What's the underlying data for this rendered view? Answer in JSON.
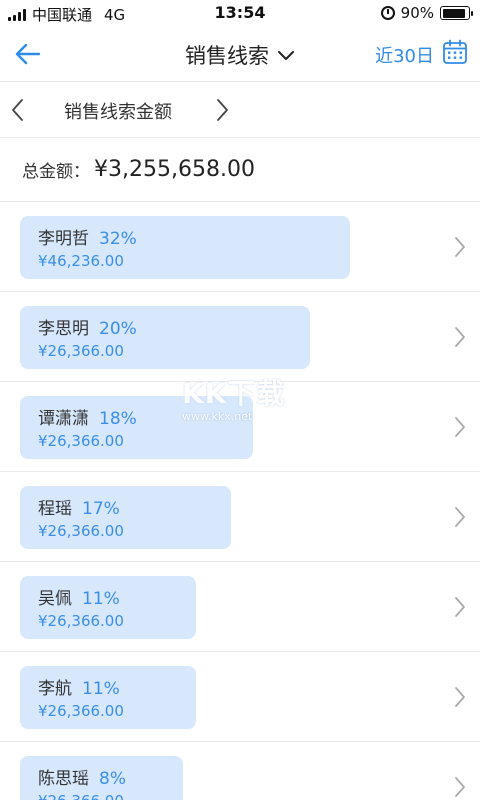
{
  "status_bar": {
    "carrier": "中国联通",
    "network": "4G",
    "time": "13:54",
    "battery_text": "90%",
    "battery_level": 0.9
  },
  "nav": {
    "title": "销售线索",
    "range_label": "近30日",
    "icons": {
      "back": "arrow-left-icon",
      "dropdown": "chevron-down-icon",
      "calendar": "calendar-icon"
    },
    "accent_color": "#2f8be6"
  },
  "subbar": {
    "title": "销售线索金额",
    "icons": {
      "prev": "chevron-left-icon",
      "next": "chevron-right-icon"
    }
  },
  "total": {
    "label": "总金额：",
    "value": "¥3,255,658.00"
  },
  "rows": [
    {
      "name": "李明哲",
      "percent": "32%",
      "amount": "¥46,236.00",
      "share": 0.75
    },
    {
      "name": "李思明",
      "percent": "20%",
      "amount": "¥26,366.00",
      "share": 0.66
    },
    {
      "name": "谭潇潇",
      "percent": "18%",
      "amount": "¥26,366.00",
      "share": 0.53
    },
    {
      "name": "程瑶",
      "percent": "17%",
      "amount": "¥26,366.00",
      "share": 0.48
    },
    {
      "name": "吴佩",
      "percent": "11%",
      "amount": "¥26,366.00",
      "share": 0.4
    },
    {
      "name": "李航",
      "percent": "11%",
      "amount": "¥26,366.00",
      "share": 0.4
    },
    {
      "name": "陈思瑶",
      "percent": "8%",
      "amount": "¥26,366.00",
      "share": 0.37
    }
  ],
  "watermark": {
    "logo_text": "KK下载",
    "url_text": "www.kkx.net"
  }
}
